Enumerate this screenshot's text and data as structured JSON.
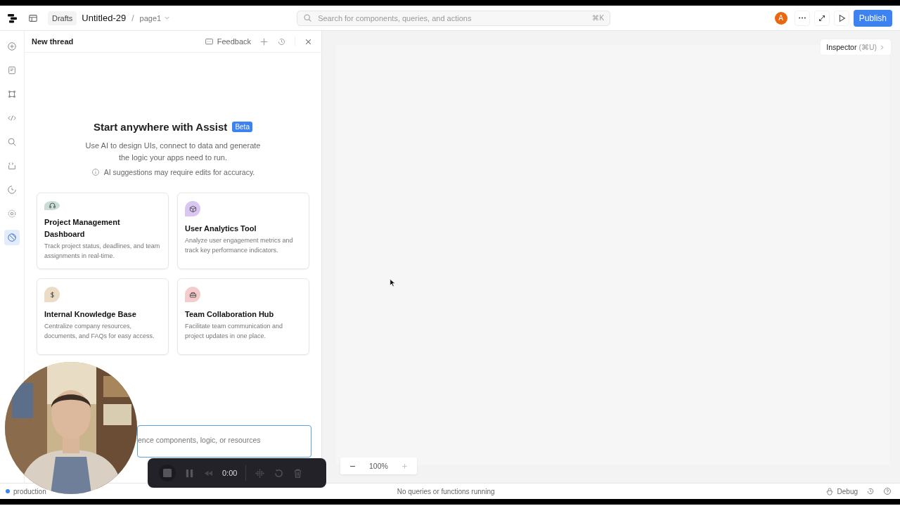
{
  "header": {
    "crumb": "Drafts",
    "app_title": "Untitled-29",
    "separator": "/",
    "page": "page1",
    "search": {
      "placeholder": "Search for components, queries, and actions",
      "shortcut": "⌘K"
    },
    "avatar": "A",
    "publish": "Publish"
  },
  "rail": [
    {
      "selected": false
    },
    {
      "selected": false
    },
    {
      "selected": false
    },
    {
      "selected": false
    },
    {
      "selected": false
    },
    {
      "selected": false
    },
    {
      "selected": false
    },
    {
      "selected": false
    },
    {
      "selected": true
    }
  ],
  "panel": {
    "title": "New thread",
    "feedback": "Feedback",
    "heading": "Start anywhere with Assist",
    "badge": "Beta",
    "intro": "Use AI to design UIs, connect to data and generate the logic your apps need to run.",
    "notice": "AI suggestions may require edits for accuracy.",
    "cards": [
      {
        "color": "#c9ddd6",
        "title": "Project Management Dashboard",
        "text": "Track project status, deadlines, and team assignments in real-time."
      },
      {
        "color": "#d9c6f2",
        "title": "User Analytics Tool",
        "text": "Analyze user engagement metrics and track key performance indicators."
      },
      {
        "color": "#ecdcc6",
        "title": "Internal Knowledge Base",
        "text": "Centralize company resources, documents, and FAQs for easy access."
      },
      {
        "color": "#f4cccc",
        "title": "Team Collaboration Hub",
        "text": "Facilitate team communication and project updates in one place."
      }
    ],
    "prompt_placeholder": "ence components, logic, or resources"
  },
  "canvas": {
    "inspector": "Inspector",
    "inspector_shortcut": "(⌘U)",
    "zoom": "100%"
  },
  "recorder": {
    "time": "0:00"
  },
  "status": {
    "environment": "production",
    "message": "No queries or functions running",
    "debug": "Debug"
  }
}
